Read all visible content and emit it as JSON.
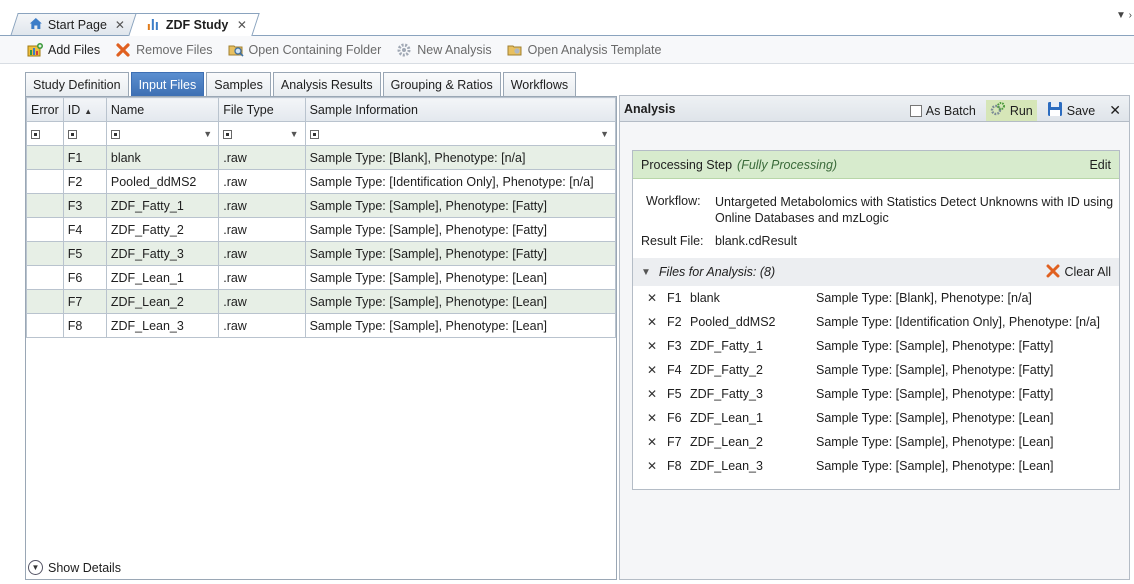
{
  "doc_tabs": [
    {
      "label": "Start Page",
      "icon": "home-icon",
      "active": false
    },
    {
      "label": "ZDF Study",
      "icon": "bar-chart-icon",
      "active": true
    }
  ],
  "toolbar": {
    "add_files": "Add Files",
    "remove_files": "Remove Files",
    "open_folder": "Open Containing Folder",
    "new_analysis": "New Analysis",
    "open_template": "Open Analysis Template"
  },
  "inner_tabs": [
    "Study Definition",
    "Input Files",
    "Samples",
    "Analysis Results",
    "Grouping & Ratios",
    "Workflows"
  ],
  "active_inner_tab": "Input Files",
  "table": {
    "headers": {
      "error": "Error",
      "id": "ID",
      "name": "Name",
      "file_type": "File Type",
      "sample_info": "Sample Information"
    },
    "rows": [
      {
        "id": "F1",
        "name": "blank",
        "type": ".raw",
        "info": "Sample Type: [Blank], Phenotype: [n/a]"
      },
      {
        "id": "F2",
        "name": "Pooled_ddMS2",
        "type": ".raw",
        "info": "Sample Type: [Identification Only], Phenotype: [n/a]"
      },
      {
        "id": "F3",
        "name": "ZDF_Fatty_1",
        "type": ".raw",
        "info": "Sample Type: [Sample], Phenotype: [Fatty]"
      },
      {
        "id": "F4",
        "name": "ZDF_Fatty_2",
        "type": ".raw",
        "info": "Sample Type: [Sample], Phenotype: [Fatty]"
      },
      {
        "id": "F5",
        "name": "ZDF_Fatty_3",
        "type": ".raw",
        "info": "Sample Type: [Sample], Phenotype: [Fatty]"
      },
      {
        "id": "F6",
        "name": "ZDF_Lean_1",
        "type": ".raw",
        "info": "Sample Type: [Sample], Phenotype: [Lean]"
      },
      {
        "id": "F7",
        "name": "ZDF_Lean_2",
        "type": ".raw",
        "info": "Sample Type: [Sample], Phenotype: [Lean]"
      },
      {
        "id": "F8",
        "name": "ZDF_Lean_3",
        "type": ".raw",
        "info": "Sample Type: [Sample], Phenotype: [Lean]"
      }
    ]
  },
  "show_details": "Show Details",
  "analysis": {
    "title": "Analysis",
    "as_batch": "As Batch",
    "run": "Run",
    "save": "Save",
    "processing_step": "Processing Step",
    "processing_mode": "(Fully Processing)",
    "edit": "Edit",
    "workflow_label": "Workflow:",
    "workflow_value": "Untargeted Metabolomics with Statistics Detect Unknowns with ID using Online Databases and mzLogic",
    "result_label": "Result File:",
    "result_value": "blank.cdResult",
    "files_label": "Files for Analysis: (8)",
    "clear_all": "Clear All"
  },
  "colors": {
    "accent": "#3d6fb3",
    "row_alt": "#e7efe6",
    "proc_head": "#d7ebcd"
  }
}
